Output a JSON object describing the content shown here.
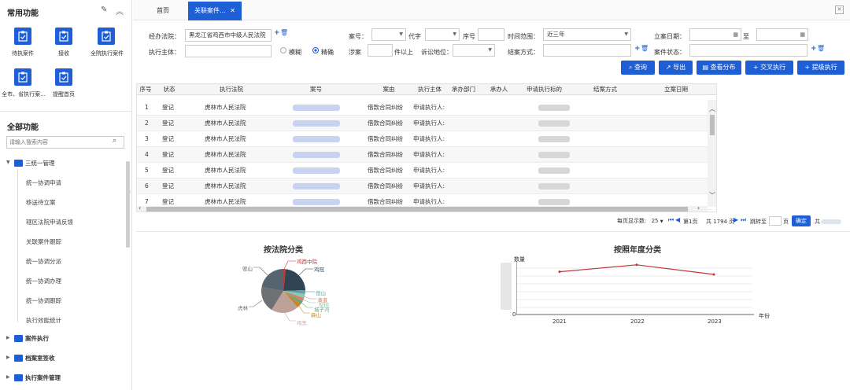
{
  "sidebar": {
    "common_title": "常用功能",
    "quick": [
      {
        "label": "待执案件",
        "icon": "clipboard-icon"
      },
      {
        "label": "接收",
        "icon": "clipboard-icon"
      },
      {
        "label": "全院执行案件",
        "icon": "clipboard-icon"
      },
      {
        "label": "全市、省执行案...",
        "icon": "clipboard-icon"
      },
      {
        "label": "提醒首页",
        "icon": "clipboard-icon"
      }
    ],
    "all_title": "全部功能",
    "search_placeholder": "请输入搜索内容",
    "tree": {
      "group1": "三统一管理",
      "sub": [
        "统一协调申请",
        "移送待立案",
        "辖区法院申请反馈",
        "关联案件跟踪",
        "统一协调分派",
        "统一协调办理",
        "统一协调跟踪",
        "执行效能统计"
      ],
      "group2": "案件执行",
      "group3": "档案室签收",
      "group4": "执行案件管理"
    }
  },
  "tabs": [
    "首页",
    "关联案件..."
  ],
  "form": {
    "court_label": "经办法院：",
    "court_value": "黑龙江省鸡西市中级人民法院",
    "caseyear_label": "案号：",
    "code_label": "代字",
    "seq_label": "序号",
    "range_label": "时间范围：",
    "range_value": "近三年",
    "filed_label": "立案日期：",
    "to_label": "至",
    "subject_label": "执行主体：",
    "fuzzy": "模糊",
    "exact": "精确",
    "amount_label": "涉案",
    "amount_suffix": "件以上",
    "status_label": "诉讼地位：",
    "close_label": "结案方式：",
    "casestate_label": "案件状态："
  },
  "buttons": [
    "查询",
    "导出",
    "查看分布",
    "交叉执行",
    "提级执行"
  ],
  "table": {
    "headers": [
      "序号",
      "状态",
      "执行法院",
      "案号",
      "案由",
      "执行主体",
      "承办部门",
      "承办人",
      "申请执行标的",
      "结案方式",
      "立案日期"
    ],
    "rows": [
      {
        "no": "1",
        "status": "登记",
        "court": "虎林市人民法院",
        "cause": "借款合同纠纷",
        "subject": "申请执行人:"
      },
      {
        "no": "2",
        "status": "登记",
        "court": "虎林市人民法院",
        "cause": "借款合同纠纷",
        "subject": "申请执行人:"
      },
      {
        "no": "3",
        "status": "登记",
        "court": "虎林市人民法院",
        "cause": "借款合同纠纷",
        "subject": "申请执行人:"
      },
      {
        "no": "4",
        "status": "登记",
        "court": "虎林市人民法院",
        "cause": "借款合同纠纷",
        "subject": "申请执行人:"
      },
      {
        "no": "5",
        "status": "登记",
        "court": "虎林市人民法院",
        "cause": "借款合同纠纷",
        "subject": "申请执行人:"
      },
      {
        "no": "6",
        "status": "登记",
        "court": "虎林市人民法院",
        "cause": "借款合同纠纷",
        "subject": "申请执行人:"
      },
      {
        "no": "7",
        "status": "登记",
        "court": "虎林市人民法院",
        "cause": "借款合同纠纷",
        "subject": "申请执行人:"
      }
    ]
  },
  "pager": {
    "per_page_label": "每页显示数:",
    "per_page": "25",
    "page_prefix": "第",
    "page": "1",
    "page_suffix": "页",
    "total_pages": "共 1794 页",
    "jump_label": "跳转至",
    "jump_suffix": "页",
    "confirm": "确定",
    "total_prefix": "共"
  },
  "pie": {
    "title": "按法院分类",
    "labels": [
      "鸡西中院",
      "鸡冠",
      "恒山",
      "梨树",
      "滴道",
      "城子河",
      "麻山",
      "鸡东",
      "虎林",
      "密山"
    ],
    "colors": [
      "#c23531",
      "#2f4554",
      "#61a0a8",
      "#d48265",
      "#91c7ae",
      "#749f83",
      "#ca8622",
      "#bda29a",
      "#6e7074",
      "#546570"
    ]
  },
  "chart_data": {
    "type": "line",
    "title": "按照年度分类",
    "ylabel": "数量",
    "xlabel": "年份",
    "categories": [
      "2021",
      "2022",
      "2023"
    ],
    "series": [
      {
        "values": [
          0.8,
          0.93,
          0.75
        ]
      }
    ],
    "ylim_label": "0",
    "color": "#c23531"
  }
}
